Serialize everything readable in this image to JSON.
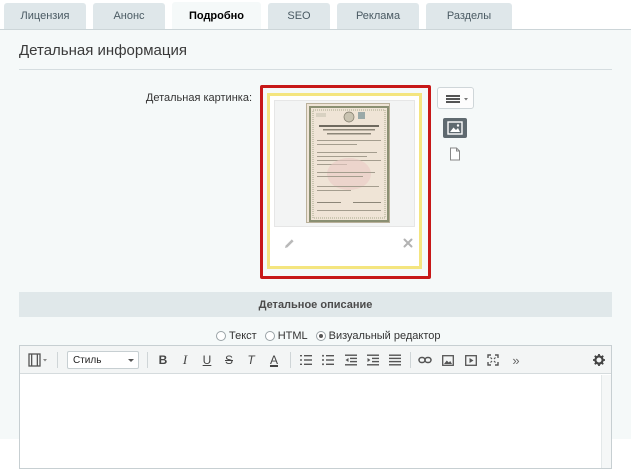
{
  "tabs": [
    {
      "label": "Лицензия",
      "active": false
    },
    {
      "label": "Анонс",
      "active": false
    },
    {
      "label": "Подробно",
      "active": true
    },
    {
      "label": "SEO",
      "active": false
    },
    {
      "label": "Реклама",
      "active": false
    },
    {
      "label": "Разделы",
      "active": false
    }
  ],
  "section": {
    "title": "Детальная информация",
    "detail_picture_label": "Детальная картинка:"
  },
  "detail_description": {
    "header": "Детальное описание",
    "modes": [
      {
        "label": "Текст",
        "checked": false
      },
      {
        "label": "HTML",
        "checked": false
      },
      {
        "label": "Визуальный редактор",
        "checked": true
      }
    ]
  },
  "editor": {
    "style_select_value": "Стиль",
    "toolbar_icons": [
      "source-mode-icon",
      "bold-icon",
      "italic-icon",
      "underline-icon",
      "strikethrough-icon",
      "remove-format-icon",
      "text-color-icon",
      "ordered-list-icon",
      "unordered-list-icon",
      "outdent-icon",
      "indent-icon",
      "justify-icon",
      "link-icon",
      "image-icon",
      "video-icon",
      "fullscreen-icon",
      "more-icon",
      "settings-icon"
    ],
    "glyphs": {
      "bold": "B",
      "italic": "I",
      "underline": "U",
      "strike": "S",
      "remove_format": "T",
      "text_color": "A",
      "more": "»"
    }
  },
  "colors": {
    "tab_bg": "#dfe7ea",
    "panel_bg": "#f5f9f9",
    "highlight_red": "#c71818",
    "highlight_yellow": "#f4e57f",
    "header_bg": "#e0e8ea"
  },
  "icons": {
    "edit": "pencil-icon",
    "delete": "close-icon",
    "menu": "hamburger-icon",
    "image_mode": "image-icon",
    "file_mode": "file-icon"
  }
}
